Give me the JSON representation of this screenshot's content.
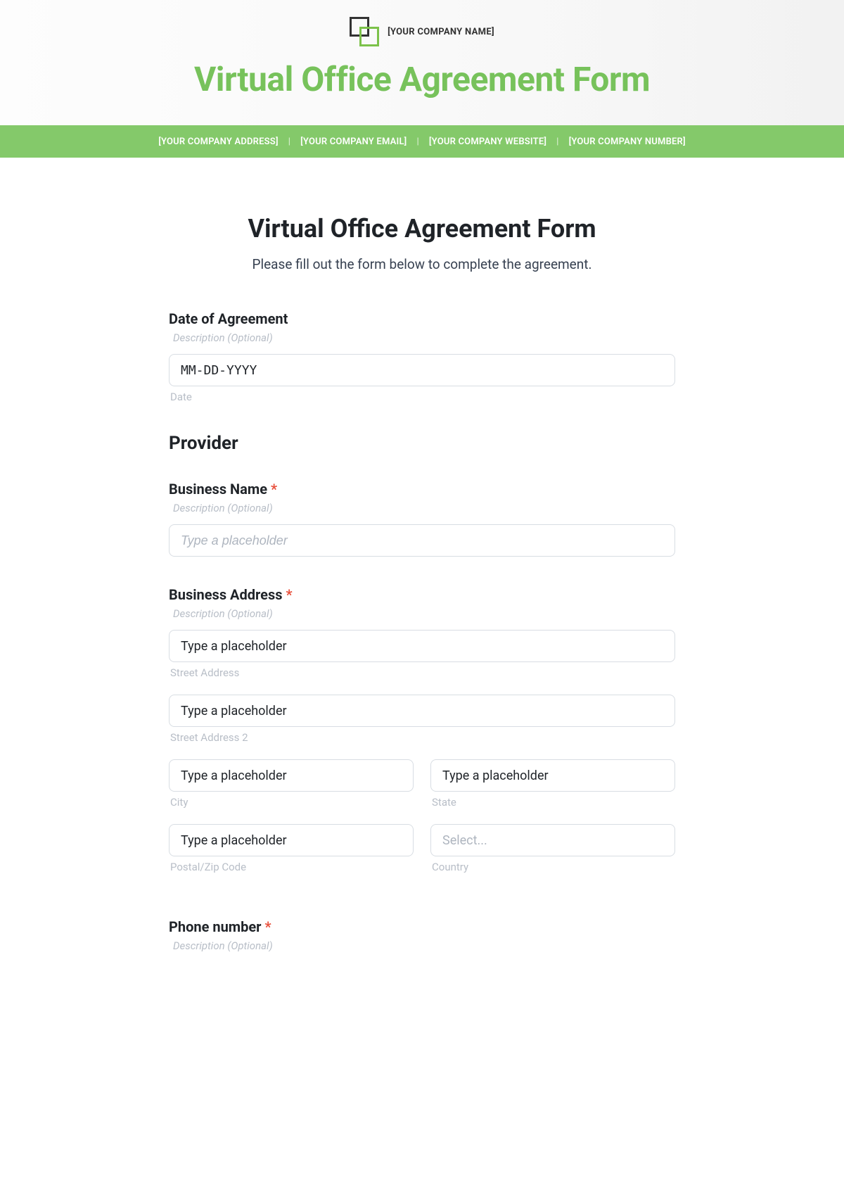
{
  "header": {
    "company_name": "[YOUR COMPANY NAME]",
    "hero_title": "Virtual Office Agreement Form",
    "bar": {
      "address": "[YOUR COMPANY ADDRESS]",
      "email": "[YOUR COMPANY EMAIL]",
      "website": "[YOUR COMPANY WEBSITE]",
      "number": "[YOUR COMPANY NUMBER]"
    }
  },
  "form": {
    "title": "Virtual Office Agreement Form",
    "subtitle": "Please fill out the form below to complete the agreement.",
    "date": {
      "label": "Date of Agreement",
      "desc": "Description (Optional)",
      "placeholder": "MM-DD-YYYY",
      "sublabel": "Date"
    },
    "provider_heading": "Provider",
    "business_name": {
      "label": "Business Name",
      "desc": "Description (Optional)",
      "placeholder": "Type a placeholder"
    },
    "business_address": {
      "label": "Business Address",
      "desc": "Description (Optional)",
      "street": {
        "placeholder": "Type a placeholder",
        "sublabel": "Street Address"
      },
      "street2": {
        "placeholder": "Type a placeholder",
        "sublabel": "Street Address 2"
      },
      "city": {
        "placeholder": "Type a placeholder",
        "sublabel": "City"
      },
      "state": {
        "placeholder": "Type a placeholder",
        "sublabel": "State"
      },
      "postal": {
        "placeholder": "Type a placeholder",
        "sublabel": "Postal/Zip Code"
      },
      "country": {
        "placeholder": "Select...",
        "sublabel": "Country"
      }
    },
    "phone": {
      "label": "Phone number",
      "desc": "Description (Optional)"
    },
    "required_mark": "*"
  }
}
